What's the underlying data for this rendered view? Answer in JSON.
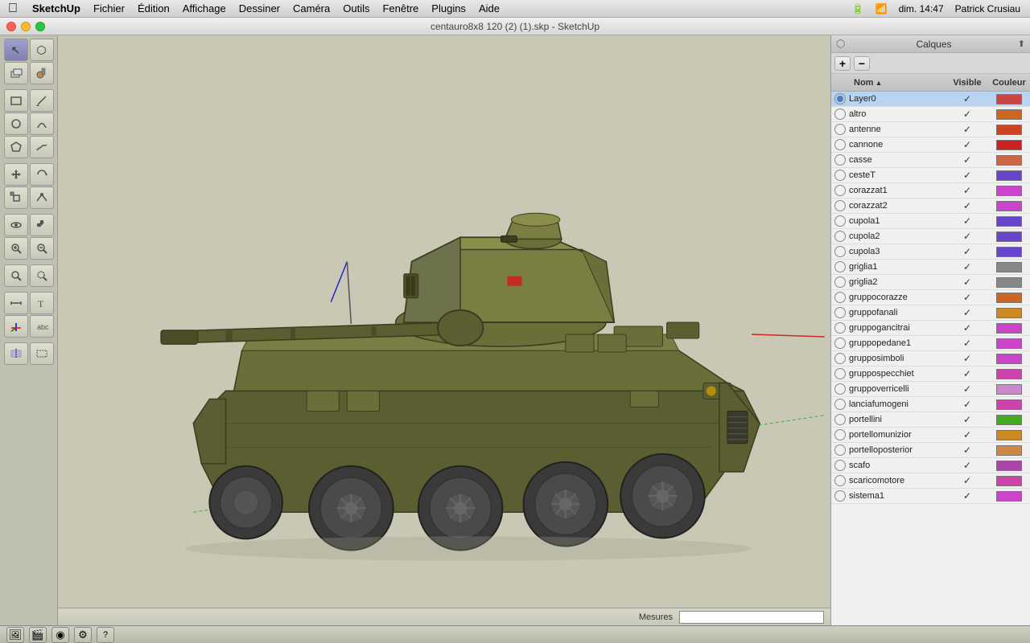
{
  "menubar": {
    "apple": "⌘",
    "items": [
      "SketchUp",
      "Fichier",
      "Édition",
      "Affichage",
      "Dessiner",
      "Caméra",
      "Outils",
      "Fenêtre",
      "Plugins",
      "Aide"
    ],
    "right": {
      "battery_icon": "🔋",
      "wifi_icon": "📶",
      "time": "dim. 14:47",
      "user": "Patrick Crusiau"
    }
  },
  "titlebar": {
    "title": "centauro8x8 120 (2) (1).skp - SketchUp"
  },
  "calques": {
    "title": "Calques",
    "columns": {
      "nom": "Nom",
      "visible": "Visible",
      "couleur": "Couleur"
    },
    "layers": [
      {
        "name": "Layer0",
        "visible": true,
        "active": true,
        "color": "#cc4444"
      },
      {
        "name": "altro",
        "visible": true,
        "active": false,
        "color": "#cc6622"
      },
      {
        "name": "antenne",
        "visible": true,
        "active": false,
        "color": "#cc4422"
      },
      {
        "name": "cannone",
        "visible": true,
        "active": false,
        "color": "#cc2222"
      },
      {
        "name": "casse",
        "visible": true,
        "active": false,
        "color": "#cc6644"
      },
      {
        "name": "cesteT",
        "visible": true,
        "active": false,
        "color": "#6644cc"
      },
      {
        "name": "corazzat1",
        "visible": true,
        "active": false,
        "color": "#cc44cc"
      },
      {
        "name": "corazzat2",
        "visible": true,
        "active": false,
        "color": "#cc44cc"
      },
      {
        "name": "cupola1",
        "visible": true,
        "active": false,
        "color": "#6644cc"
      },
      {
        "name": "cupola2",
        "visible": true,
        "active": false,
        "color": "#6644cc"
      },
      {
        "name": "cupola3",
        "visible": true,
        "active": false,
        "color": "#6644cc"
      },
      {
        "name": "griglia1",
        "visible": true,
        "active": false,
        "color": "#888888"
      },
      {
        "name": "griglia2",
        "visible": true,
        "active": false,
        "color": "#888888"
      },
      {
        "name": "gruppocorazze",
        "visible": true,
        "active": false,
        "color": "#cc6622"
      },
      {
        "name": "gruppofanali",
        "visible": true,
        "active": false,
        "color": "#cc8822"
      },
      {
        "name": "gruppogancitrai",
        "visible": true,
        "active": false,
        "color": "#cc44cc"
      },
      {
        "name": "gruppopedane1",
        "visible": true,
        "active": false,
        "color": "#cc44cc"
      },
      {
        "name": "grupposimboli",
        "visible": true,
        "active": false,
        "color": "#cc44cc"
      },
      {
        "name": "gruppospecchiet",
        "visible": true,
        "active": false,
        "color": "#cc44aa"
      },
      {
        "name": "gruppoverricelli",
        "visible": true,
        "active": false,
        "color": "#cc88cc"
      },
      {
        "name": "lanciafumogeni",
        "visible": true,
        "active": false,
        "color": "#cc44aa"
      },
      {
        "name": "portellini",
        "visible": true,
        "active": false,
        "color": "#44aa22"
      },
      {
        "name": "portellomunizior",
        "visible": true,
        "active": false,
        "color": "#cc8822"
      },
      {
        "name": "portelloposterior",
        "visible": true,
        "active": false,
        "color": "#cc8844"
      },
      {
        "name": "scafo",
        "visible": true,
        "active": false,
        "color": "#aa44aa"
      },
      {
        "name": "scaricomotore",
        "visible": true,
        "active": false,
        "color": "#cc44aa"
      },
      {
        "name": "sistema1",
        "visible": true,
        "active": false,
        "color": "#cc44cc"
      }
    ]
  },
  "statusbar": {
    "label": "Mesures"
  },
  "toolbar": {
    "tools": [
      {
        "icon": "↖",
        "name": "select"
      },
      {
        "icon": "⬡",
        "name": "make-component"
      },
      {
        "icon": "✋",
        "name": "push-pull"
      },
      {
        "icon": "✏",
        "name": "pencil"
      },
      {
        "icon": "⬛",
        "name": "rectangle"
      },
      {
        "icon": "⬤",
        "name": "circle"
      },
      {
        "icon": "△",
        "name": "polygon"
      },
      {
        "icon": "⌒",
        "name": "arc"
      },
      {
        "icon": "✱",
        "name": "rotate"
      },
      {
        "icon": "⤢",
        "name": "scale"
      },
      {
        "icon": "⟳",
        "name": "orbit"
      },
      {
        "icon": "↔",
        "name": "pan"
      },
      {
        "icon": "⊕",
        "name": "zoom-plus"
      },
      {
        "icon": "⊖",
        "name": "zoom-minus"
      },
      {
        "icon": "✂",
        "name": "trim"
      },
      {
        "icon": "📏",
        "name": "measure"
      },
      {
        "icon": "🖊",
        "name": "text"
      },
      {
        "icon": "👁",
        "name": "section"
      },
      {
        "icon": "🔲",
        "name": "hidden"
      }
    ]
  }
}
